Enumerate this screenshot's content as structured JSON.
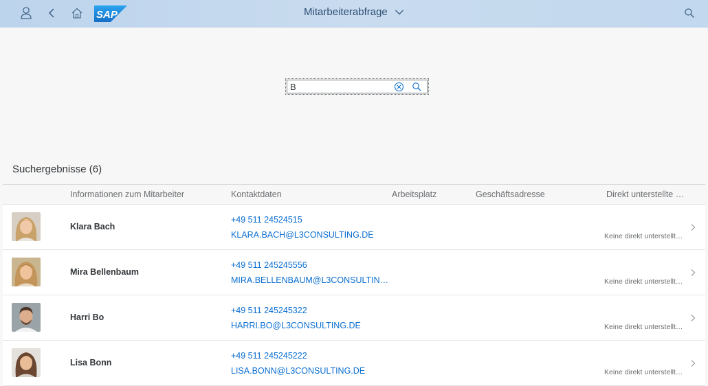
{
  "shell": {
    "title": "Mitarbeiterabfrage",
    "icons": [
      "user-icon",
      "back-icon",
      "home-icon",
      "sap-logo",
      "chevron-down-icon",
      "search-icon"
    ],
    "logo_text": "SAP"
  },
  "search": {
    "value": "B",
    "icons": [
      "clear-icon",
      "search-icon"
    ]
  },
  "results": {
    "title": "Suchergebnisse (6)",
    "columns": [
      "Informationen zum Mitarbeiter",
      "Kontaktdaten",
      "Arbeitsplatz",
      "Geschäftsadresse",
      "Direkt unterstellte …"
    ],
    "rows": [
      {
        "name": "Klara Bach",
        "phone": "+49 511 24524515",
        "email": "KLARA.BACH@L3CONSULTING.DE",
        "direct": "Keine direkt unterstellt…",
        "avatar": "avatar-woman-blonde"
      },
      {
        "name": "Mira Bellenbaum",
        "phone": "+49 511 245245556",
        "email": "MIRA.BELLENBAUM@L3CONSULTIN…",
        "direct": "Keine direkt unterstellt…",
        "avatar": "avatar-woman-blonde-2"
      },
      {
        "name": "Harri Bo",
        "phone": "+49 511 245245322",
        "email": "HARRI.BO@L3CONSULTING.DE",
        "direct": "Keine direkt unterstellt…",
        "avatar": "avatar-man"
      },
      {
        "name": "Lisa Bonn",
        "phone": "+49 511 245245222",
        "email": "LISA.BONN@L3CONSULTING.DE",
        "direct": "Keine direkt unterstellt…",
        "avatar": "avatar-woman-brunette"
      }
    ]
  },
  "colors": {
    "link": "#0a6ed1",
    "shell_bg": "#c4d9ee",
    "logo_blue": "#1b8ce3"
  }
}
